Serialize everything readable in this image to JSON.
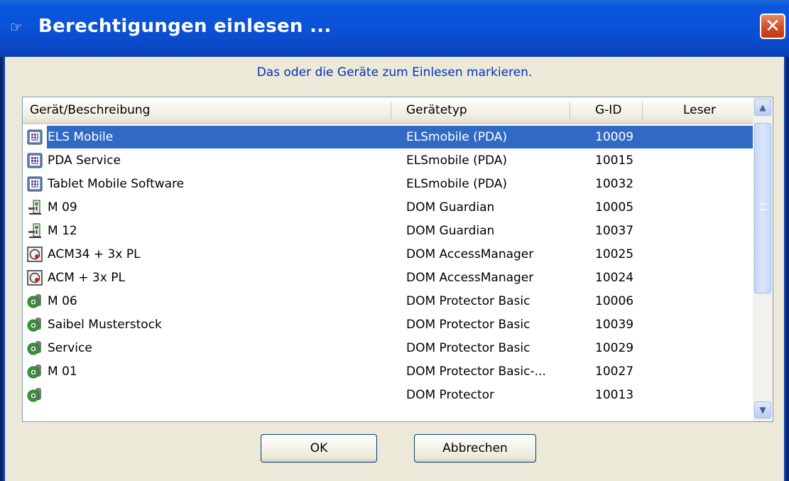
{
  "window": {
    "title": "Berechtigungen einlesen ...",
    "title_icon": "pointing-hand-icon",
    "close_glyph": "✕",
    "icon_char": "☞"
  },
  "instruction": "Das oder die Geräte zum Einlesen markieren.",
  "columns": [
    "Gerät/Beschreibung",
    "Gerätetyp",
    "G-ID",
    "Leser"
  ],
  "rows": [
    {
      "name": "ELS Mobile",
      "type": "ELSmobile (PDA)",
      "gid": "10009",
      "icon": "pda-icon",
      "selected": true
    },
    {
      "name": "PDA Service",
      "type": "ELSmobile (PDA)",
      "gid": "10015",
      "icon": "pda-icon"
    },
    {
      "name": "Tablet Mobile Software",
      "type": "ELSmobile (PDA)",
      "gid": "10032",
      "icon": "pda-icon"
    },
    {
      "name": "M 09",
      "type": "DOM Guardian",
      "gid": "10005",
      "icon": "guardian-icon"
    },
    {
      "name": "M 12",
      "type": "DOM Guardian",
      "gid": "10037",
      "icon": "guardian-icon"
    },
    {
      "name": "ACM34 + 3x PL",
      "type": "DOM AccessManager",
      "gid": "10025",
      "icon": "access-manager-icon"
    },
    {
      "name": "ACM + 3x PL",
      "type": "DOM AccessManager",
      "gid": "10024",
      "icon": "access-manager-icon"
    },
    {
      "name": "M 06",
      "type": "DOM Protector Basic",
      "gid": "10006",
      "icon": "protector-icon"
    },
    {
      "name": "Saibel Musterstock",
      "type": "DOM Protector Basic",
      "gid": "10039",
      "icon": "protector-icon"
    },
    {
      "name": "Service",
      "type": "DOM Protector Basic",
      "gid": "10029",
      "icon": "protector-icon"
    },
    {
      "name": "M 01",
      "type": "DOM Protector Basic-...",
      "gid": "10027",
      "icon": "protector-icon"
    },
    {
      "name": "",
      "type": "DOM Protector",
      "gid": "10013",
      "icon": "protector-icon"
    }
  ],
  "buttons": {
    "ok": "OK",
    "cancel": "Abbrechen"
  },
  "scrollbar": {
    "up_glyph": "▲",
    "down_glyph": "▼"
  },
  "colors": {
    "titlebar": "#0a57de",
    "selection": "#316ac5",
    "instruction_text": "#0033bb",
    "dialog_bg": "#ece9d8"
  }
}
